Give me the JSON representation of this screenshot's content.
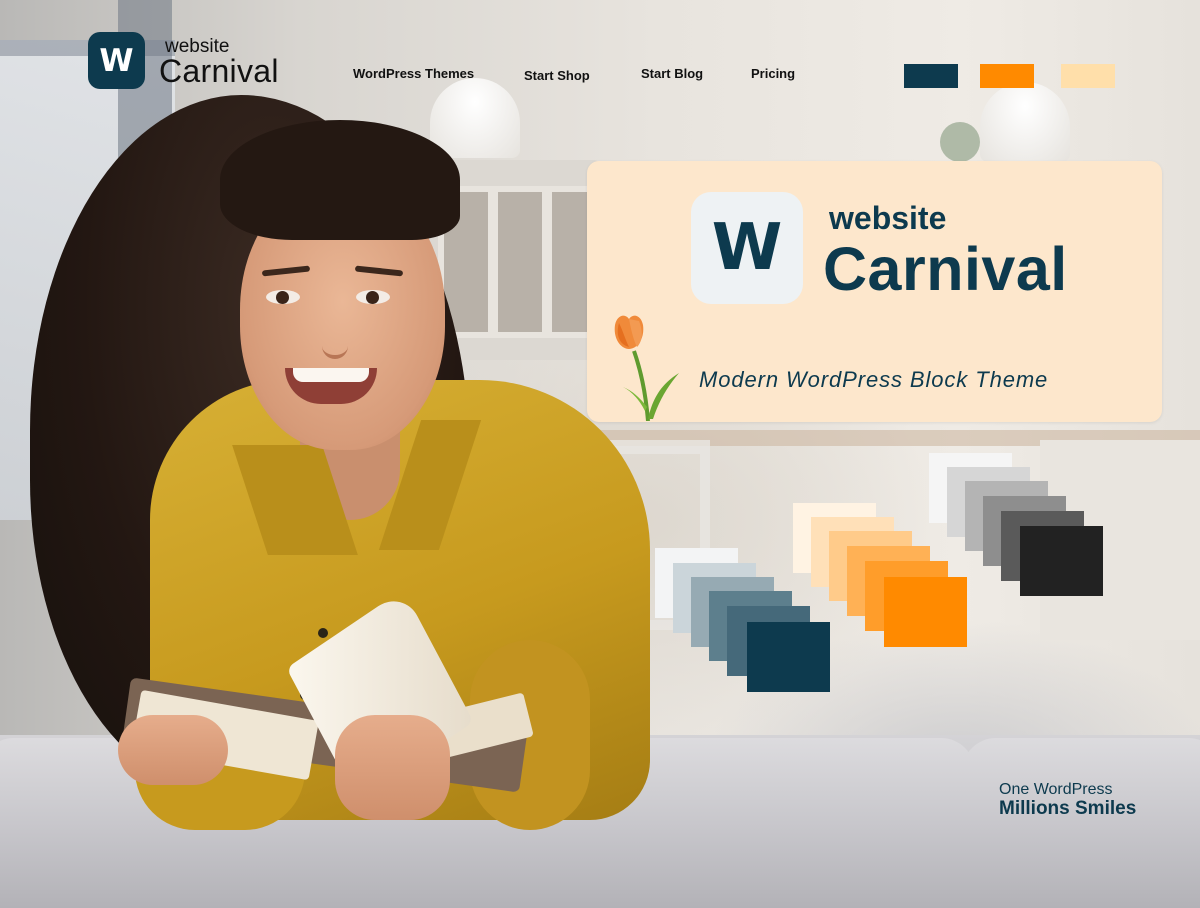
{
  "header": {
    "logo_letter": "W",
    "logo_small": "website",
    "logo_big": "Carnival",
    "nav": [
      {
        "label": "WordPress Themes"
      },
      {
        "label": "Start Shop"
      },
      {
        "label": "Start Blog"
      },
      {
        "label": "Pricing"
      }
    ],
    "swatches": [
      "#0d3a4e",
      "#ff8a00",
      "#ffdfaa"
    ]
  },
  "card": {
    "logo_letter": "W",
    "small": "website",
    "big": "Carnival",
    "tagline": "Modern WordPress Block Theme"
  },
  "palettes": {
    "blue": [
      "#f3f4f5",
      "#cbd5da",
      "#96aab3",
      "#5d7f8d",
      "#45697a",
      "#0d3a4e"
    ],
    "orange": [
      "#fff3e3",
      "#ffe0b8",
      "#ffcb8a",
      "#ffb155",
      "#ff9d2a",
      "#ff8a00"
    ],
    "gray": [
      "#f5f5f5",
      "#d6d6d6",
      "#b4b4b4",
      "#8e8e8e",
      "#5a5a5a",
      "#222222"
    ]
  },
  "footer": {
    "line1": "One WordPress",
    "line2": "Millions Smiles"
  },
  "colors": {
    "brand_dark": "#0d3a4e",
    "brand_orange": "#ff8a00",
    "brand_peach": "#fde7cc"
  }
}
